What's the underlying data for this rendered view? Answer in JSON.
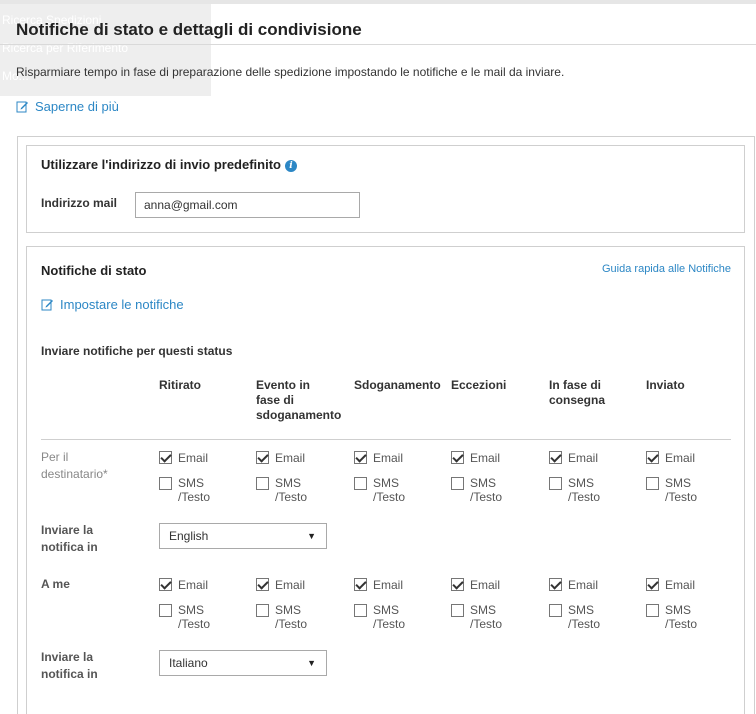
{
  "ghost_menu": {
    "item1": "Ricerca Spedizioni",
    "item2": "Ricerca per Riferimento",
    "item3": "Mo..."
  },
  "page": {
    "title": "Notifiche di stato e dettagli di condivisione",
    "intro": "Risparmiare tempo in fase di preparazione delle spedizione impostando le notifiche e le mail da inviare.",
    "learn_more": "Saperne di più"
  },
  "default_address": {
    "title": "Utilizzare l'indirizzo di invio predefinito",
    "info_icon": "i",
    "email_label": "Indirizzo mail",
    "email_value": "anna@gmail.com"
  },
  "status_notifications": {
    "title": "Notifiche di stato",
    "quick_guide": "Guida rapida alle Notifiche",
    "set_notifications": "Impostare le notifiche",
    "send_for_label": "Inviare notifiche per questi status",
    "columns": [
      {
        "l1": "Ritirato",
        "l2": "",
        "l3": ""
      },
      {
        "l1": "Evento in",
        "l2": "fase di",
        "l3": "sdoganamento"
      },
      {
        "l1": "Sdoganamento",
        "l2": "",
        "l3": ""
      },
      {
        "l1": "Eccezioni",
        "l2": "",
        "l3": ""
      },
      {
        "l1": "In fase di",
        "l2": "consegna",
        "l3": ""
      },
      {
        "l1": "Inviato",
        "l2": "",
        "l3": ""
      }
    ],
    "recipient": {
      "label_l1": "Per il",
      "label_l2": "destinatario*",
      "email_checked": [
        true,
        true,
        true,
        true,
        true,
        true
      ],
      "sms_checked": [
        false,
        false,
        false,
        false,
        false,
        false
      ]
    },
    "me": {
      "label_l1": "A me",
      "email_checked": [
        true,
        true,
        true,
        true,
        true,
        true
      ],
      "sms_checked": [
        false,
        false,
        false,
        false,
        false,
        false
      ]
    },
    "option_email": "Email",
    "option_sms_l1": "SMS",
    "option_sms_l2": "/Testo",
    "send_in_l1": "Inviare la",
    "send_in_l2": "notifica in",
    "recipient_language": "English",
    "me_language": "Italiano",
    "dropdown_arrow": "▼"
  }
}
